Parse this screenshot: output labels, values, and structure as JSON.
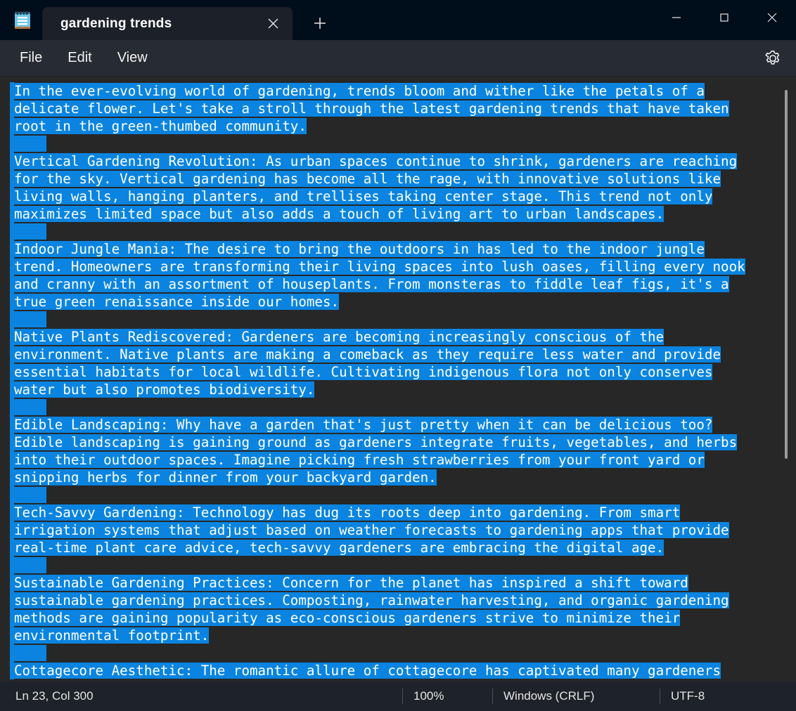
{
  "window": {
    "app_icon": "notepad-icon",
    "minimize_label": "—",
    "maximize_label": "□",
    "close_label": "✕"
  },
  "tabs": {
    "items": [
      {
        "title": "gardening trends",
        "close_label": "✕",
        "active": true
      }
    ],
    "new_tab_label": "+"
  },
  "menubar": {
    "items": [
      {
        "label": "File"
      },
      {
        "label": "Edit"
      },
      {
        "label": "View"
      }
    ],
    "settings_label": "gear-icon"
  },
  "editor": {
    "selection_color": "#0a84e0",
    "background_color": "#272727",
    "text_color": "#ffffff",
    "lines": [
      {
        "text": "In the ever-evolving world of gardening, trends bloom and wither like the petals of a",
        "selected": true
      },
      {
        "text": "delicate flower. Let's take a stroll through the latest gardening trends that have taken",
        "selected": true
      },
      {
        "text": "root in the green-thumbed community.",
        "selected": true
      },
      {
        "text": "    ",
        "selected": true
      },
      {
        "text": "Vertical Gardening Revolution: As urban spaces continue to shrink, gardeners are reaching",
        "selected": true
      },
      {
        "text": "for the sky. Vertical gardening has become all the rage, with innovative solutions like",
        "selected": true
      },
      {
        "text": "living walls, hanging planters, and trellises taking center stage. This trend not only",
        "selected": true
      },
      {
        "text": "maximizes limited space but also adds a touch of living art to urban landscapes.",
        "selected": true
      },
      {
        "text": "    ",
        "selected": true
      },
      {
        "text": "Indoor Jungle Mania: The desire to bring the outdoors in has led to the indoor jungle",
        "selected": true
      },
      {
        "text": "trend. Homeowners are transforming their living spaces into lush oases, filling every nook",
        "selected": true
      },
      {
        "text": "and cranny with an assortment of houseplants. From monsteras to fiddle leaf figs, it's a",
        "selected": true
      },
      {
        "text": "true green renaissance inside our homes.",
        "selected": true
      },
      {
        "text": "    ",
        "selected": true
      },
      {
        "text": "Native Plants Rediscovered: Gardeners are becoming increasingly conscious of the",
        "selected": true
      },
      {
        "text": "environment. Native plants are making a comeback as they require less water and provide",
        "selected": true
      },
      {
        "text": "essential habitats for local wildlife. Cultivating indigenous flora not only conserves",
        "selected": true
      },
      {
        "text": "water but also promotes biodiversity.",
        "selected": true
      },
      {
        "text": "    ",
        "selected": true
      },
      {
        "text": "Edible Landscaping: Why have a garden that's just pretty when it can be delicious too?",
        "selected": true
      },
      {
        "text": "Edible landscaping is gaining ground as gardeners integrate fruits, vegetables, and herbs",
        "selected": true
      },
      {
        "text": "into their outdoor spaces. Imagine picking fresh strawberries from your front yard or",
        "selected": true
      },
      {
        "text": "snipping herbs for dinner from your backyard garden.",
        "selected": true
      },
      {
        "text": "    ",
        "selected": true
      },
      {
        "text": "Tech-Savvy Gardening: Technology has dug its roots deep into gardening. From smart",
        "selected": true
      },
      {
        "text": "irrigation systems that adjust based on weather forecasts to gardening apps that provide",
        "selected": true
      },
      {
        "text": "real-time plant care advice, tech-savvy gardeners are embracing the digital age.",
        "selected": true
      },
      {
        "text": "    ",
        "selected": true
      },
      {
        "text": "Sustainable Gardening Practices: Concern for the planet has inspired a shift toward",
        "selected": true
      },
      {
        "text": "sustainable gardening practices. Composting, rainwater harvesting, and organic gardening",
        "selected": true
      },
      {
        "text": "methods are gaining popularity as eco-conscious gardeners strive to minimize their",
        "selected": true
      },
      {
        "text": "environmental footprint.",
        "selected": true
      },
      {
        "text": "    ",
        "selected": true
      },
      {
        "text": "Cottagecore Aesthetic: The romantic allure of cottagecore has captivated many gardeners",
        "selected": true
      }
    ]
  },
  "scrollbar": {
    "orientation": "vertical"
  },
  "statusbar": {
    "cursor_position": "Ln 23, Col 300",
    "zoom": "100%",
    "line_ending": "Windows (CRLF)",
    "encoding": "UTF-8"
  }
}
